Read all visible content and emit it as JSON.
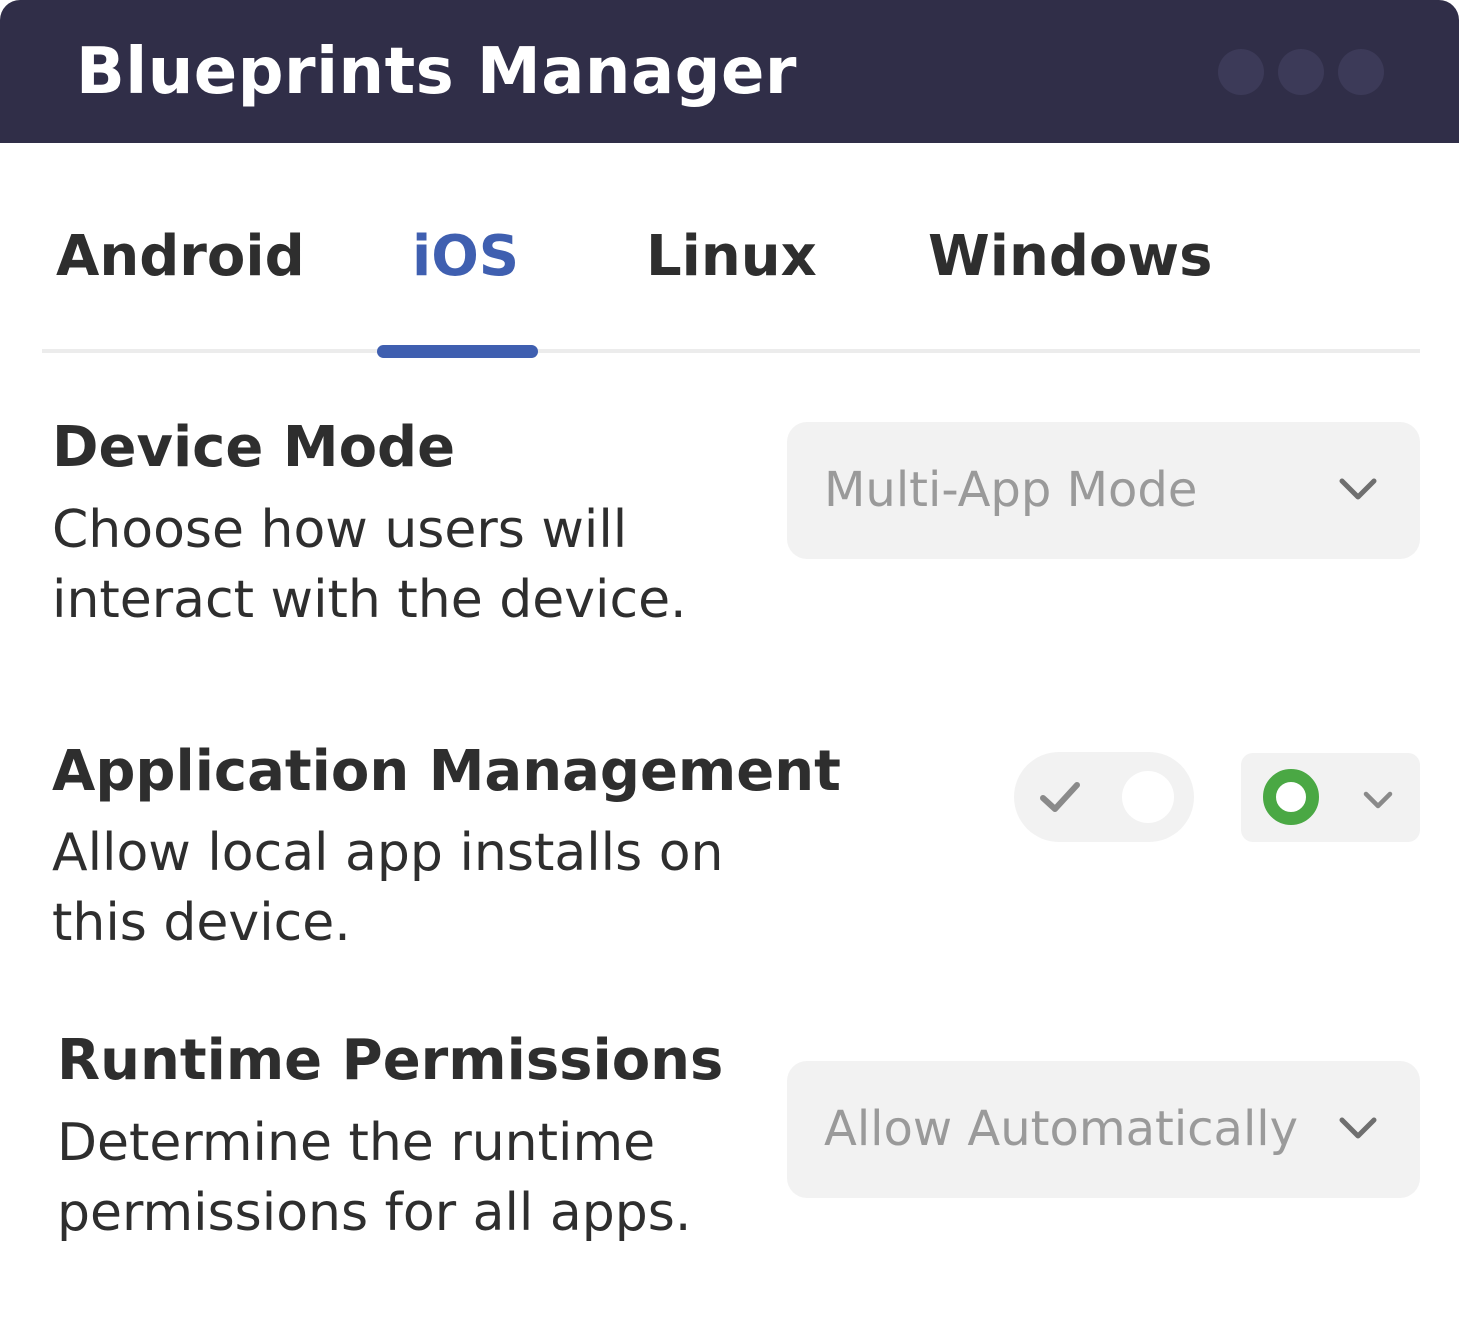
{
  "window": {
    "title": "Blueprints Manager",
    "controls": [
      "dot-1",
      "dot-2",
      "dot-3"
    ]
  },
  "tabs": [
    {
      "label": "Android",
      "active": false
    },
    {
      "label": "iOS",
      "active": true
    },
    {
      "label": "Linux",
      "active": false
    },
    {
      "label": "Windows",
      "active": false
    }
  ],
  "settings": {
    "device_mode": {
      "title": "Device Mode",
      "description": "Choose how users will interact with the device.",
      "selected": "Multi-App Mode"
    },
    "application_management": {
      "title": "Application Management",
      "description": "Allow local app installs on this device.",
      "toggle_on": true,
      "status": "green-ring"
    },
    "runtime_permissions": {
      "title": "Runtime Permissions",
      "description": "Determine the runtime permissions for all apps.",
      "selected": "Allow Automatically"
    }
  },
  "colors": {
    "titlebar": "#302e48",
    "accent": "#3f5fb0",
    "status_green": "#4aa844",
    "control_bg": "#f2f2f2"
  },
  "icons": [
    "chevron-down-icon",
    "check-icon",
    "status-ring-icon"
  ]
}
